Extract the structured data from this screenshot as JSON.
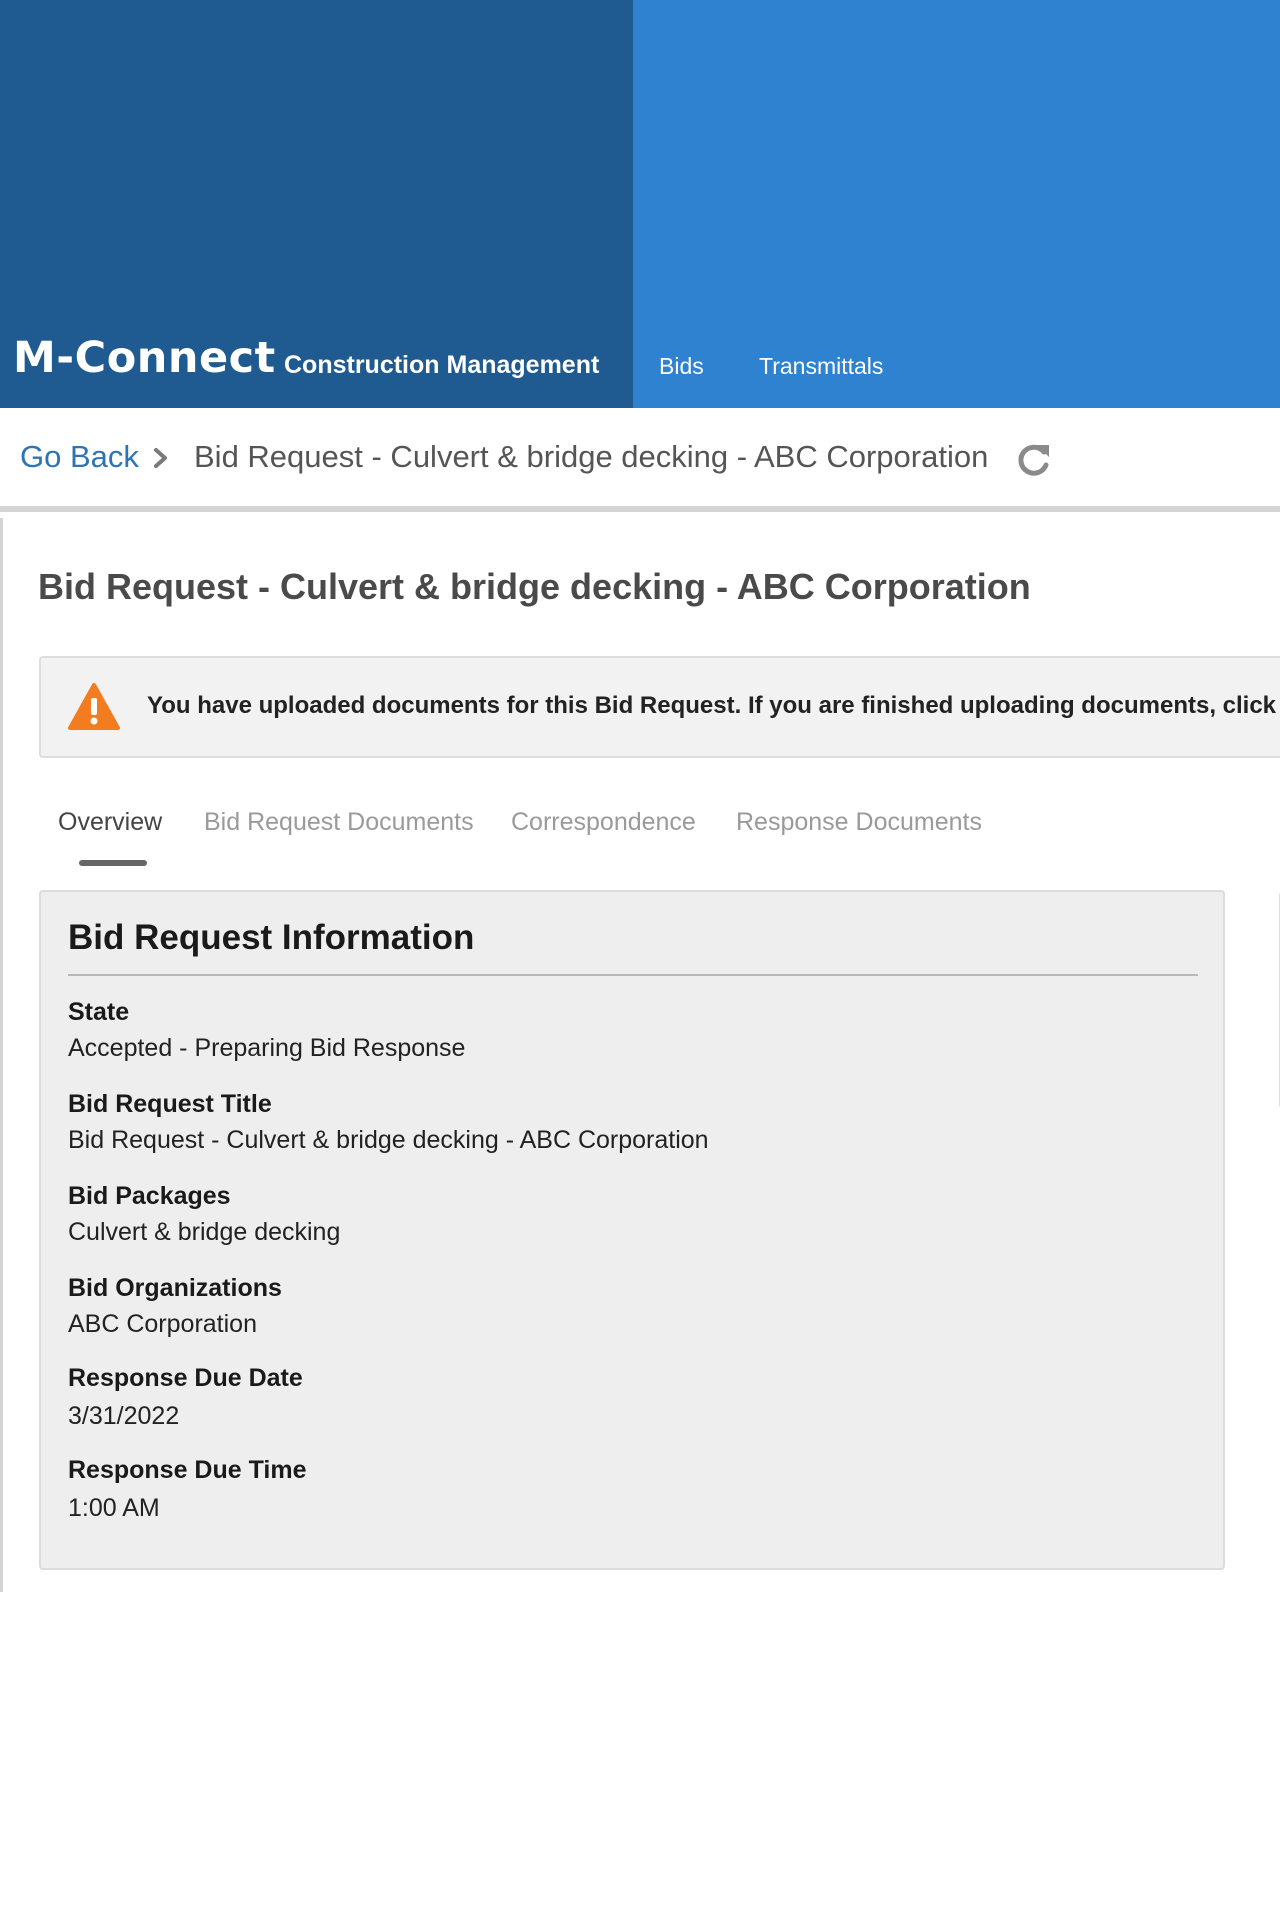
{
  "header": {
    "logo": "M-Connect",
    "app_name": "Construction Management",
    "nav": [
      {
        "label": "Bids"
      },
      {
        "label": "Transmittals"
      }
    ]
  },
  "breadcrumb": {
    "back_label": "Go Back",
    "current": "Bid Request - Culvert & bridge decking - ABC Corporation",
    "chevron_icon": "chevron-right-icon",
    "refresh_icon": "refresh-icon"
  },
  "page": {
    "title": "Bid Request - Culvert & bridge decking - ABC Corporation"
  },
  "alert": {
    "icon": "warning-icon",
    "text": "You have uploaded documents for this Bid Request. If you are finished uploading documents, click th",
    "color": "#f47c20"
  },
  "tabs": [
    {
      "label": "Overview",
      "active": true
    },
    {
      "label": "Bid Request Documents",
      "active": false
    },
    {
      "label": "Correspondence",
      "active": false
    },
    {
      "label": "Response Documents",
      "active": false
    }
  ],
  "info": {
    "title": "Bid Request Information",
    "fields": [
      {
        "label": "State",
        "value": "Accepted - Preparing Bid Response"
      },
      {
        "label": "Bid Request Title",
        "value": "Bid Request - Culvert & bridge decking - ABC Corporation"
      },
      {
        "label": "Bid Packages",
        "value": "Culvert & bridge decking"
      },
      {
        "label": "Bid Organizations",
        "value": "ABC Corporation"
      },
      {
        "label": "Response Due Date",
        "value": "3/31/2022"
      },
      {
        "label": "Response Due Time",
        "value": "1:00 AM"
      }
    ]
  },
  "colors": {
    "header_dark": "#1f5b91",
    "header_light": "#2e82cf",
    "link": "#2e74b5"
  }
}
